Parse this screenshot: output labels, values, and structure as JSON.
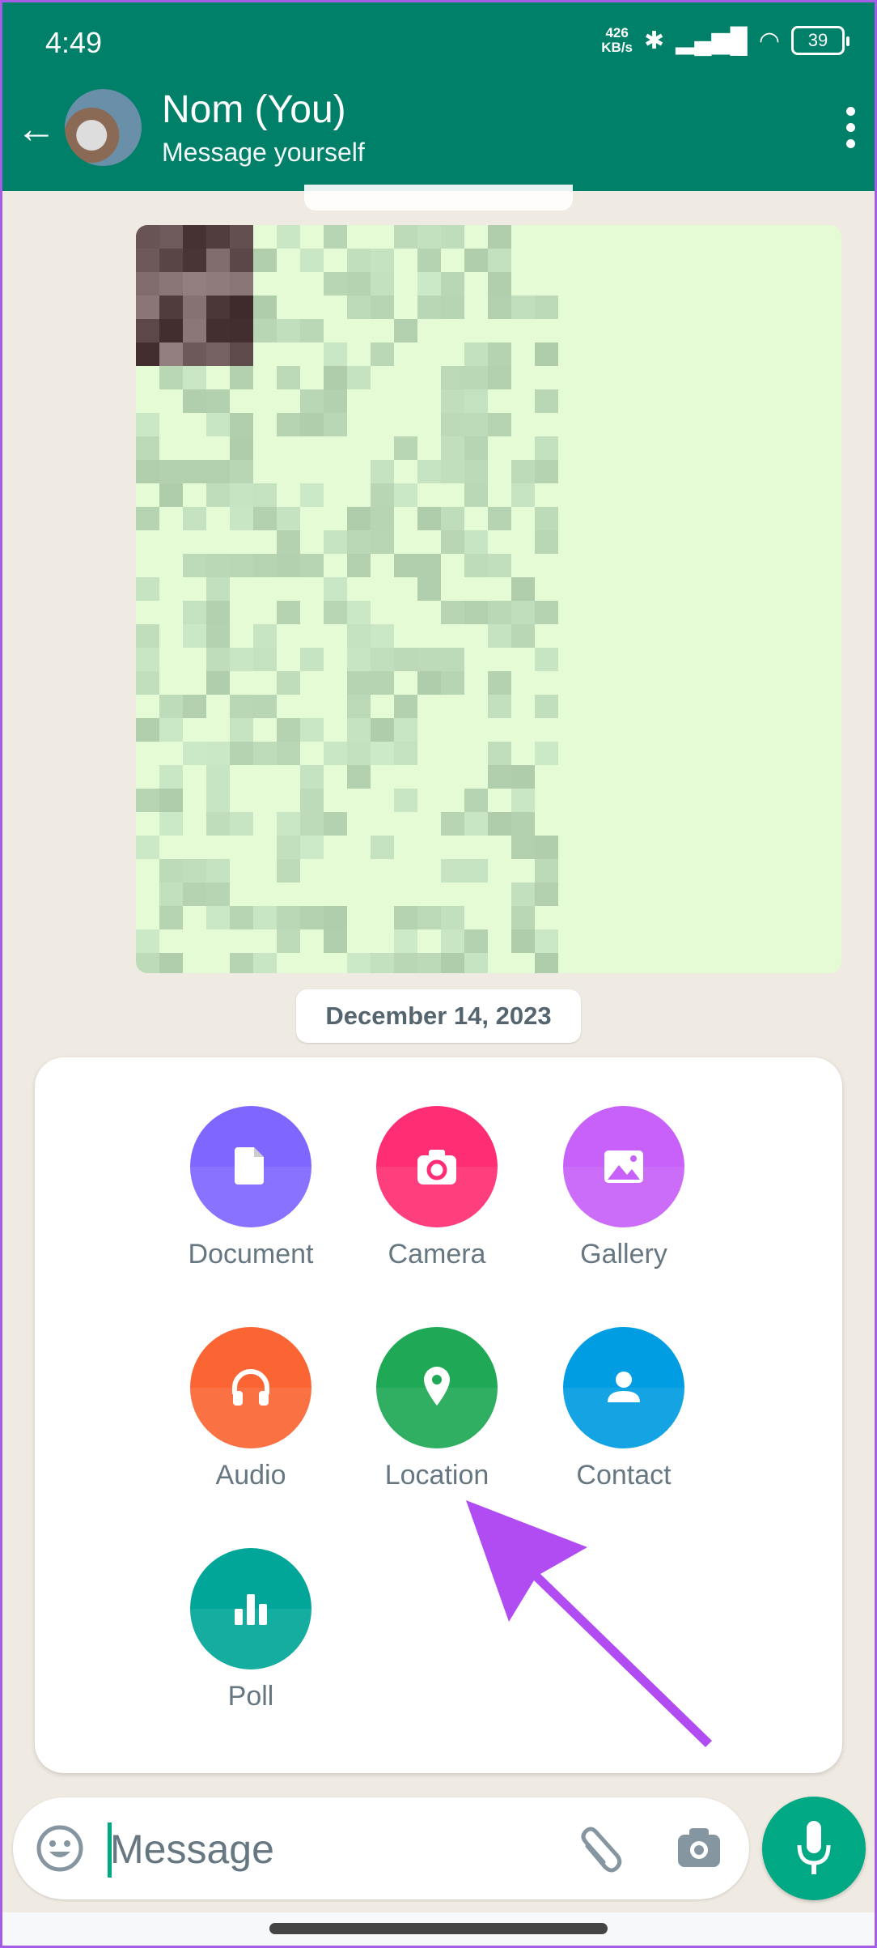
{
  "status_bar": {
    "time": "4:49",
    "speed_value": "426",
    "speed_unit": "KB/s",
    "battery": "39"
  },
  "header": {
    "title": "Nom (You)",
    "subtitle": "Message yourself",
    "back_icon": "arrow-left-icon",
    "menu_icon": "more-vert-icon"
  },
  "chat": {
    "date_chip": "December 14, 2023"
  },
  "attach_menu": {
    "items": [
      {
        "label": "Document",
        "icon": "document-icon",
        "color": "#7f66ff"
      },
      {
        "label": "Camera",
        "icon": "camera-icon",
        "color": "#ff2e74"
      },
      {
        "label": "Gallery",
        "icon": "gallery-icon",
        "color": "#c861fa"
      },
      {
        "label": "Audio",
        "icon": "headphones-icon",
        "color": "#fa6533"
      },
      {
        "label": "Location",
        "icon": "location-pin-icon",
        "color": "#1fa855"
      },
      {
        "label": "Contact",
        "icon": "contact-icon",
        "color": "#009de2"
      },
      {
        "label": "Poll",
        "icon": "poll-icon",
        "color": "#02a698"
      }
    ]
  },
  "composer": {
    "placeholder": "Message",
    "accent": "#00a884"
  },
  "annotation": {
    "arrow_color": "#b14cf2"
  }
}
